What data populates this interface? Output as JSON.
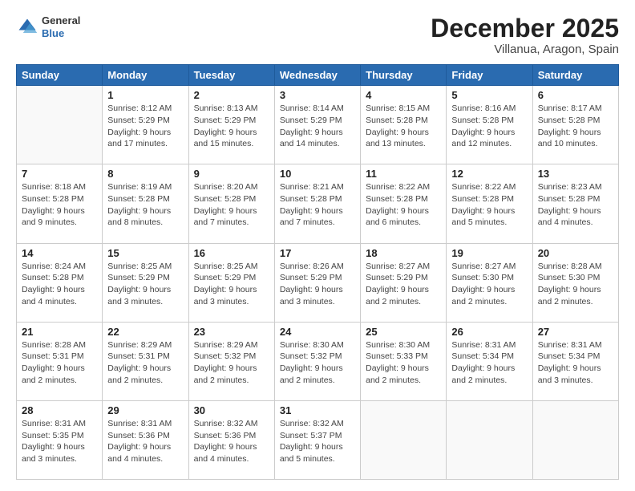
{
  "logo": {
    "general": "General",
    "blue": "Blue"
  },
  "header": {
    "month_year": "December 2025",
    "location": "Villanua, Aragon, Spain"
  },
  "days_of_week": [
    "Sunday",
    "Monday",
    "Tuesday",
    "Wednesday",
    "Thursday",
    "Friday",
    "Saturday"
  ],
  "weeks": [
    [
      {
        "day": "",
        "info": ""
      },
      {
        "day": "1",
        "info": "Sunrise: 8:12 AM\nSunset: 5:29 PM\nDaylight: 9 hours\nand 17 minutes."
      },
      {
        "day": "2",
        "info": "Sunrise: 8:13 AM\nSunset: 5:29 PM\nDaylight: 9 hours\nand 15 minutes."
      },
      {
        "day": "3",
        "info": "Sunrise: 8:14 AM\nSunset: 5:29 PM\nDaylight: 9 hours\nand 14 minutes."
      },
      {
        "day": "4",
        "info": "Sunrise: 8:15 AM\nSunset: 5:28 PM\nDaylight: 9 hours\nand 13 minutes."
      },
      {
        "day": "5",
        "info": "Sunrise: 8:16 AM\nSunset: 5:28 PM\nDaylight: 9 hours\nand 12 minutes."
      },
      {
        "day": "6",
        "info": "Sunrise: 8:17 AM\nSunset: 5:28 PM\nDaylight: 9 hours\nand 10 minutes."
      }
    ],
    [
      {
        "day": "7",
        "info": "Sunrise: 8:18 AM\nSunset: 5:28 PM\nDaylight: 9 hours\nand 9 minutes."
      },
      {
        "day": "8",
        "info": "Sunrise: 8:19 AM\nSunset: 5:28 PM\nDaylight: 9 hours\nand 8 minutes."
      },
      {
        "day": "9",
        "info": "Sunrise: 8:20 AM\nSunset: 5:28 PM\nDaylight: 9 hours\nand 7 minutes."
      },
      {
        "day": "10",
        "info": "Sunrise: 8:21 AM\nSunset: 5:28 PM\nDaylight: 9 hours\nand 7 minutes."
      },
      {
        "day": "11",
        "info": "Sunrise: 8:22 AM\nSunset: 5:28 PM\nDaylight: 9 hours\nand 6 minutes."
      },
      {
        "day": "12",
        "info": "Sunrise: 8:22 AM\nSunset: 5:28 PM\nDaylight: 9 hours\nand 5 minutes."
      },
      {
        "day": "13",
        "info": "Sunrise: 8:23 AM\nSunset: 5:28 PM\nDaylight: 9 hours\nand 4 minutes."
      }
    ],
    [
      {
        "day": "14",
        "info": "Sunrise: 8:24 AM\nSunset: 5:28 PM\nDaylight: 9 hours\nand 4 minutes."
      },
      {
        "day": "15",
        "info": "Sunrise: 8:25 AM\nSunset: 5:29 PM\nDaylight: 9 hours\nand 3 minutes."
      },
      {
        "day": "16",
        "info": "Sunrise: 8:25 AM\nSunset: 5:29 PM\nDaylight: 9 hours\nand 3 minutes."
      },
      {
        "day": "17",
        "info": "Sunrise: 8:26 AM\nSunset: 5:29 PM\nDaylight: 9 hours\nand 3 minutes."
      },
      {
        "day": "18",
        "info": "Sunrise: 8:27 AM\nSunset: 5:29 PM\nDaylight: 9 hours\nand 2 minutes."
      },
      {
        "day": "19",
        "info": "Sunrise: 8:27 AM\nSunset: 5:30 PM\nDaylight: 9 hours\nand 2 minutes."
      },
      {
        "day": "20",
        "info": "Sunrise: 8:28 AM\nSunset: 5:30 PM\nDaylight: 9 hours\nand 2 minutes."
      }
    ],
    [
      {
        "day": "21",
        "info": "Sunrise: 8:28 AM\nSunset: 5:31 PM\nDaylight: 9 hours\nand 2 minutes."
      },
      {
        "day": "22",
        "info": "Sunrise: 8:29 AM\nSunset: 5:31 PM\nDaylight: 9 hours\nand 2 minutes."
      },
      {
        "day": "23",
        "info": "Sunrise: 8:29 AM\nSunset: 5:32 PM\nDaylight: 9 hours\nand 2 minutes."
      },
      {
        "day": "24",
        "info": "Sunrise: 8:30 AM\nSunset: 5:32 PM\nDaylight: 9 hours\nand 2 minutes."
      },
      {
        "day": "25",
        "info": "Sunrise: 8:30 AM\nSunset: 5:33 PM\nDaylight: 9 hours\nand 2 minutes."
      },
      {
        "day": "26",
        "info": "Sunrise: 8:31 AM\nSunset: 5:34 PM\nDaylight: 9 hours\nand 2 minutes."
      },
      {
        "day": "27",
        "info": "Sunrise: 8:31 AM\nSunset: 5:34 PM\nDaylight: 9 hours\nand 3 minutes."
      }
    ],
    [
      {
        "day": "28",
        "info": "Sunrise: 8:31 AM\nSunset: 5:35 PM\nDaylight: 9 hours\nand 3 minutes."
      },
      {
        "day": "29",
        "info": "Sunrise: 8:31 AM\nSunset: 5:36 PM\nDaylight: 9 hours\nand 4 minutes."
      },
      {
        "day": "30",
        "info": "Sunrise: 8:32 AM\nSunset: 5:36 PM\nDaylight: 9 hours\nand 4 minutes."
      },
      {
        "day": "31",
        "info": "Sunrise: 8:32 AM\nSunset: 5:37 PM\nDaylight: 9 hours\nand 5 minutes."
      },
      {
        "day": "",
        "info": ""
      },
      {
        "day": "",
        "info": ""
      },
      {
        "day": "",
        "info": ""
      }
    ]
  ]
}
